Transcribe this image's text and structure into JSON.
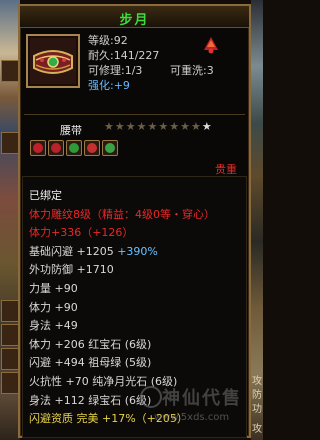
{
  "item": {
    "name": "步月",
    "level_line": "等级:92",
    "durability_line": "耐久:141/227",
    "repairable_line": "可修理:1/3",
    "rewash_line": "可重洗:3",
    "enhance_label": "强化:",
    "enhance_value": "+9",
    "sub_type": "腰带",
    "stars_total": 10,
    "stars_filled": 0,
    "gem_slots": [
      {
        "name": "red-gem",
        "color": "#c0202a"
      },
      {
        "name": "red-gem",
        "color": "#b8232b"
      },
      {
        "name": "green-gem",
        "color": "#2e9a3a"
      },
      {
        "name": "red-gem",
        "color": "#c23030"
      },
      {
        "name": "green-gem",
        "color": "#38a446"
      }
    ],
    "price_label": "贵重"
  },
  "properties": [
    {
      "parts": [
        {
          "text": "已绑定",
          "cls": "white"
        }
      ]
    },
    {
      "parts": [
        {
          "text": "体力雕纹8级（精益：4级0等・穿心）",
          "cls": "red"
        }
      ]
    },
    {
      "parts": [
        {
          "text": "体力+336",
          "cls": "red"
        },
        {
          "text": "（+126）",
          "cls": "red"
        }
      ]
    },
    {
      "parts": [
        {
          "text": "基础闪避 +1205 ",
          "cls": "grey"
        },
        {
          "text": "+390%",
          "cls": "blue"
        }
      ]
    },
    {
      "parts": [
        {
          "text": "外功防御 +1710",
          "cls": "grey"
        }
      ]
    },
    {
      "parts": [
        {
          "text": "力量 +90",
          "cls": "grey"
        }
      ]
    },
    {
      "parts": [
        {
          "text": "体力 +90",
          "cls": "grey"
        }
      ]
    },
    {
      "parts": [
        {
          "text": "身法 +49",
          "cls": "grey"
        }
      ]
    },
    {
      "parts": [
        {
          "text": "体力 +206 红宝石 (6级)",
          "cls": "grey"
        }
      ]
    },
    {
      "parts": [
        {
          "text": "闪避 +494 祖母绿 (5级)",
          "cls": "grey"
        }
      ]
    },
    {
      "parts": [
        {
          "text": "火抗性 +70 纯净月光石 (6级)",
          "cls": "grey"
        }
      ]
    },
    {
      "parts": [
        {
          "text": "身法 +112 绿宝石 (6级)",
          "cls": "grey"
        }
      ]
    },
    {
      "parts": [
        {
          "text": "闪避资质  完美 +17%（+205）",
          "cls": "yellow"
        }
      ]
    }
  ],
  "watermark": {
    "text": "神仙代售",
    "url": "www.5xds.com"
  },
  "right_edge_chars": [
    "攻",
    "防",
    "功",
    "攻"
  ],
  "colors": {
    "title": "#3fdc3f",
    "red": "#e82828",
    "blue": "#6cc0ff",
    "yellow": "#e8d34a",
    "border": "#8b6a3c"
  }
}
